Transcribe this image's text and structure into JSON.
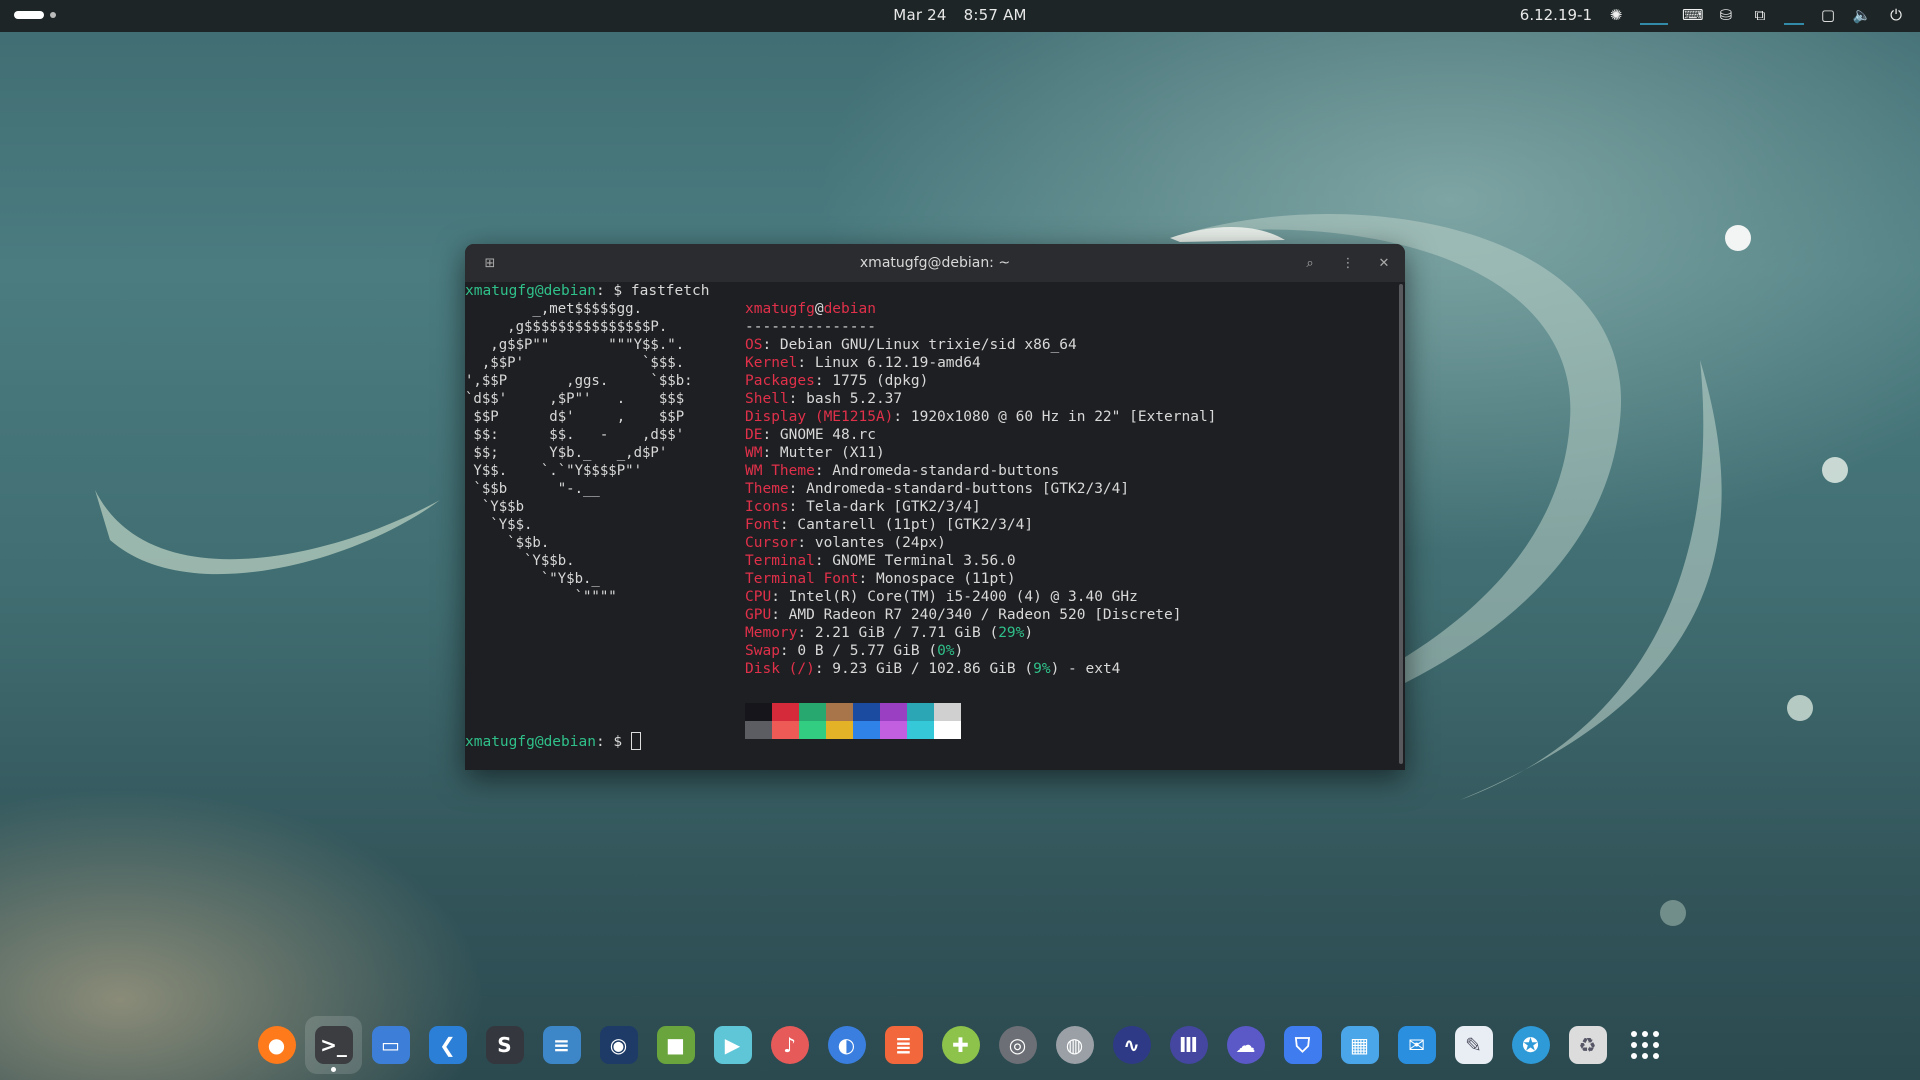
{
  "topbar": {
    "date": "Mar 24",
    "time": "8:57 AM",
    "kernel_indicator": "6.12.19-1",
    "icons": [
      "cpu-icon",
      "keyboard-icon",
      "drive-icon",
      "network-icon",
      "screen-icon",
      "volume-icon",
      "power-icon"
    ]
  },
  "terminal": {
    "title": "xmatugfg@debian: ~",
    "prompt_user": "xmatugfg@debian",
    "prompt_path": ": $ ",
    "command": "fastfetch",
    "logo": [
      "        _,met$$$$$gg.",
      "     ,g$$$$$$$$$$$$$$$P.",
      "   ,g$$P\"\"       \"\"\"Y$$.\".",
      "  ,$$P'              `$$$.",
      "',$$P       ,ggs.     `$$b:",
      "`d$$'     ,$P\"'   .    $$$",
      " $$P      d$'     ,    $$P",
      " $$:      $$.   -    ,d$$'",
      " $$;      Y$b._   _,d$P'",
      " Y$$.    `.`\"Y$$$$P\"'",
      " `$$b      \"-.__",
      "  `Y$$b",
      "   `Y$$.",
      "     `$$b.",
      "       `Y$$b.",
      "         `\"Y$b._",
      "             `\"\"\"\""
    ],
    "info_user": "xmatugfg",
    "info_at": "@",
    "info_host": "debian",
    "separator": "---------------",
    "info": [
      {
        "key": "OS",
        "value": "Debian GNU/Linux trixie/sid x86_64"
      },
      {
        "key": "Kernel",
        "value": "Linux 6.12.19-amd64"
      },
      {
        "key": "Packages",
        "value": "1775 (dpkg)"
      },
      {
        "key": "Shell",
        "value": "bash 5.2.37"
      },
      {
        "key": "Display (ME1215A)",
        "value": "1920x1080 @ 60 Hz in 22\" [External]"
      },
      {
        "key": "DE",
        "value": "GNOME 48.rc"
      },
      {
        "key": "WM",
        "value": "Mutter (X11)"
      },
      {
        "key": "WM Theme",
        "value": "Andromeda-standard-buttons"
      },
      {
        "key": "Theme",
        "value": "Andromeda-standard-buttons [GTK2/3/4]"
      },
      {
        "key": "Icons",
        "value": "Tela-dark [GTK2/3/4]"
      },
      {
        "key": "Font",
        "value": "Cantarell (11pt) [GTK2/3/4]"
      },
      {
        "key": "Cursor",
        "value": "volantes (24px)"
      },
      {
        "key": "Terminal",
        "value": "GNOME Terminal 3.56.0"
      },
      {
        "key": "Terminal Font",
        "value": "Monospace (11pt)"
      },
      {
        "key": "CPU",
        "value": "Intel(R) Core(TM) i5-2400 (4) @ 3.40 GHz"
      },
      {
        "key": "GPU",
        "value": "AMD Radeon R7 240/340 / Radeon 520 [Discrete]"
      },
      {
        "key": "Memory",
        "value": "2.21 GiB / 7.71 GiB (",
        "pct": "29%",
        "tail": ")"
      },
      {
        "key": "Swap",
        "value": "0 B / 5.77 GiB (",
        "pct": "0%",
        "tail": ")"
      },
      {
        "key": "Disk (/)",
        "value": "9.23 GiB / 102.86 GiB (",
        "pct": "9%",
        "tail": ") - ext4"
      }
    ],
    "palette_top": [
      "#15151b",
      "#d42a3a",
      "#26a86e",
      "#a8744a",
      "#1a4ba0",
      "#9a3fc2",
      "#2aa6b4",
      "#d0d0d0"
    ],
    "palette_bottom": [
      "#5b5d63",
      "#ee5a56",
      "#33cd82",
      "#e3b227",
      "#2f82e8",
      "#c15fe0",
      "#35c8d8",
      "#ffffff"
    ]
  },
  "dock": {
    "apps": [
      {
        "name": "firefox",
        "bg": "#ff7a1a",
        "glyph": "●"
      },
      {
        "name": "terminal",
        "bg": "#3b3d40",
        "glyph": ">_",
        "active": true
      },
      {
        "name": "files",
        "bg": "#3d7fd8",
        "glyph": "▭"
      },
      {
        "name": "vscode",
        "bg": "#2c7fd6",
        "glyph": "❮"
      },
      {
        "name": "sublime-text",
        "bg": "#34383e",
        "glyph": "S"
      },
      {
        "name": "settings",
        "bg": "#3d87c8",
        "glyph": "≡"
      },
      {
        "name": "steam",
        "bg": "#1d3b66",
        "glyph": "◉"
      },
      {
        "name": "minecraft",
        "bg": "#6aa43c",
        "glyph": "■"
      },
      {
        "name": "video",
        "bg": "#5fc6d8",
        "glyph": "▶"
      },
      {
        "name": "music",
        "bg": "#e65a5a",
        "glyph": "♪"
      },
      {
        "name": "connections",
        "bg": "#3a7fe0",
        "glyph": "◐"
      },
      {
        "name": "document",
        "bg": "#f2683c",
        "glyph": "≣"
      },
      {
        "name": "extensions",
        "bg": "#8dc34a",
        "glyph": "✚"
      },
      {
        "name": "disk",
        "bg": "#6c6f75",
        "glyph": "◎"
      },
      {
        "name": "image-viewer",
        "bg": "#9aa0a6",
        "glyph": "◍"
      },
      {
        "name": "monitor",
        "bg": "#2e3a86",
        "glyph": "∿"
      },
      {
        "name": "software",
        "bg": "#4446a0",
        "glyph": "Ⅲ"
      },
      {
        "name": "cloud",
        "bg": "#5b58c8",
        "glyph": "☁"
      },
      {
        "name": "store",
        "bg": "#3e7cf0",
        "glyph": "⛉"
      },
      {
        "name": "photos",
        "bg": "#4aa6e8",
        "glyph": "▦"
      },
      {
        "name": "mail",
        "bg": "#2b8fe0",
        "glyph": "✉"
      },
      {
        "name": "text-editor",
        "bg": "#e8eef4",
        "glyph": "✎"
      },
      {
        "name": "help",
        "bg": "#2f9ad8",
        "glyph": "✪"
      },
      {
        "name": "trash",
        "bg": "#dcdcdc",
        "glyph": "♻"
      }
    ]
  }
}
